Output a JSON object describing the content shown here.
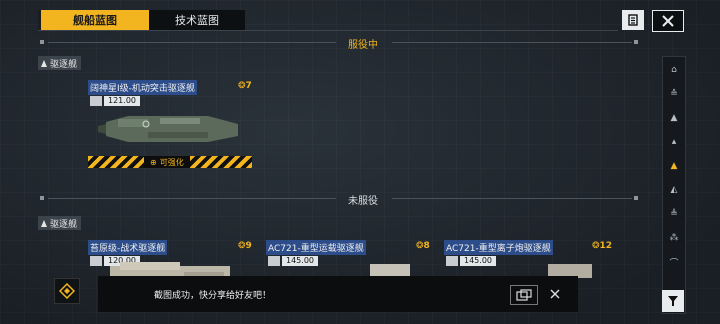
{
  "tabs": [
    {
      "label": "舰船蓝图",
      "active": true
    },
    {
      "label": "技术蓝图",
      "active": false
    }
  ],
  "header_buttons": {
    "list_icon": "list-icon",
    "close_icon": "close-icon"
  },
  "sections": {
    "in_service": {
      "title": "服役中",
      "category": "驱逐舰"
    },
    "not_in_service": {
      "title": "未服役",
      "category": "驱逐舰"
    }
  },
  "in_service_ship": {
    "name": "阔神星Ⅰ级-机动突击驱逐舰",
    "level": "7",
    "stat": "121.00",
    "upgrade_label": "可强化"
  },
  "not_in_service_ships": [
    {
      "name": "苔原级-战术驱逐舰",
      "level": "9",
      "stat": "120.00"
    },
    {
      "name": "AC721-重型运载驱逐舰",
      "level": "8",
      "stat": "145.00"
    },
    {
      "name": "AC721-重型离子炮驱逐舰",
      "level": "12",
      "stat": "145.00"
    }
  ],
  "toast": {
    "message": "截图成功，快分享给好友吧！"
  },
  "colors": {
    "accent": "#f2b51f",
    "name_highlight": "#2d4d8a",
    "background": "#1f252c"
  }
}
